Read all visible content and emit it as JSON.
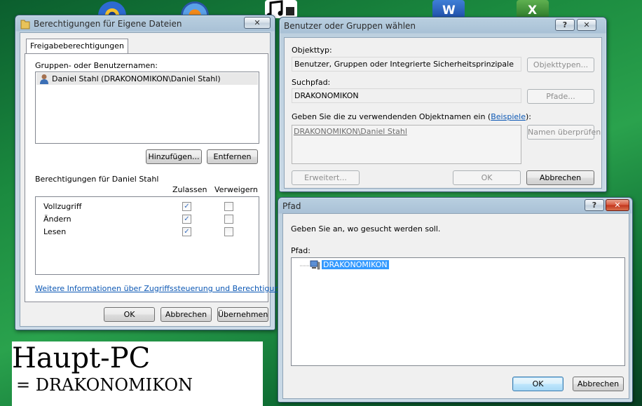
{
  "desktop": {
    "icons": [
      "disc-icon",
      "media-player-icon",
      "music-icon",
      "word-icon",
      "excel-icon"
    ]
  },
  "win_perm": {
    "title": "Berechtigungen für Eigene Dateien",
    "close": "✕",
    "tab": "Freigabeberechtigungen",
    "groups_label": "Gruppen- oder Benutzernamen:",
    "users": [
      "Daniel Stahl (DRAKONOMIKON\\Daniel Stahl)"
    ],
    "add_button": "Hinzufügen...",
    "remove_button": "Entfernen",
    "perm_label": "Berechtigungen für Daniel Stahl",
    "col_allow": "Zulassen",
    "col_deny": "Verweigern",
    "permissions": [
      {
        "name": "Vollzugriff",
        "allow": true,
        "deny": false
      },
      {
        "name": "Ändern",
        "allow": true,
        "deny": false
      },
      {
        "name": "Lesen",
        "allow": true,
        "deny": false
      }
    ],
    "more_info_link": "Weitere Informationen über Zugriffssteuerung und Berechtigungen",
    "ok": "OK",
    "cancel": "Abbrechen",
    "apply": "Übernehmen"
  },
  "win_select": {
    "title": "Benutzer oder Gruppen wählen",
    "help": "?",
    "close": "✕",
    "objtype_label": "Objekttyp:",
    "objtype_value": "Benutzer, Gruppen oder Integrierte Sicherheitsprinzipale",
    "objtype_button": "Objekttypen...",
    "path_label": "Suchpfad:",
    "path_value": "DRAKONOMIKON",
    "path_button": "Pfade...",
    "names_label_pre": "Geben Sie die zu verwendenden Objektnamen ein (",
    "names_label_link": "Beispiele",
    "names_label_post": "):",
    "names_value": "DRAKONOMIKON\\Daniel Stahl",
    "check_button": "Namen überprüfen",
    "advanced_button": "Erweitert...",
    "ok": "OK",
    "cancel": "Abbrechen"
  },
  "win_path": {
    "title": "Pfad",
    "help": "?",
    "close": "✕",
    "prompt": "Geben Sie an, wo gesucht werden soll.",
    "path_label": "Pfad:",
    "tree_item": "DRAKONOMIKON",
    "ok": "OK",
    "cancel": "Abbrechen"
  },
  "note": {
    "line1": "Haupt-PC",
    "line2": "= DRAKONOMIKON"
  }
}
